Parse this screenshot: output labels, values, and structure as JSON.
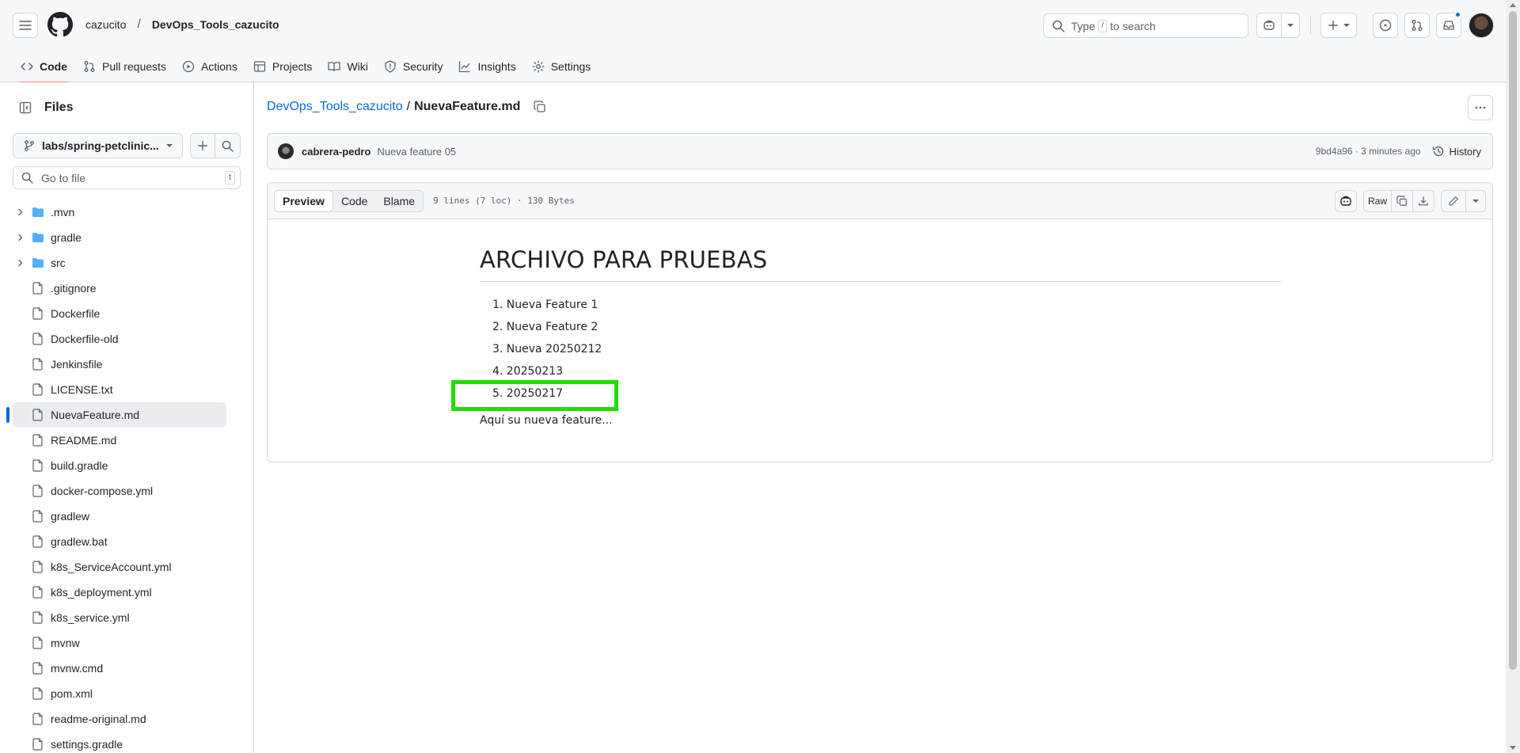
{
  "header": {
    "owner": "cazucito",
    "separator": "/",
    "repo": "DevOps_Tools_cazucito",
    "search_pre": "Type",
    "search_key": "/",
    "search_post": "to search"
  },
  "tabs": [
    {
      "label": "Code",
      "icon": "code-icon"
    },
    {
      "label": "Pull requests",
      "icon": "pull-request-icon"
    },
    {
      "label": "Actions",
      "icon": "play-icon"
    },
    {
      "label": "Projects",
      "icon": "table-icon"
    },
    {
      "label": "Wiki",
      "icon": "book-icon"
    },
    {
      "label": "Security",
      "icon": "shield-icon"
    },
    {
      "label": "Insights",
      "icon": "graph-icon"
    },
    {
      "label": "Settings",
      "icon": "gear-icon"
    }
  ],
  "sidebar": {
    "title": "Files",
    "branch": "labs/spring-petclinic...",
    "goto_placeholder": "Go to file",
    "goto_key": "t",
    "items": [
      {
        "name": ".mvn",
        "type": "dir"
      },
      {
        "name": "gradle",
        "type": "dir"
      },
      {
        "name": "src",
        "type": "dir"
      },
      {
        "name": ".gitignore",
        "type": "file"
      },
      {
        "name": "Dockerfile",
        "type": "file"
      },
      {
        "name": "Dockerfile-old",
        "type": "file"
      },
      {
        "name": "Jenkinsfile",
        "type": "file"
      },
      {
        "name": "LICENSE.txt",
        "type": "file"
      },
      {
        "name": "NuevaFeature.md",
        "type": "file",
        "selected": true
      },
      {
        "name": "README.md",
        "type": "file"
      },
      {
        "name": "build.gradle",
        "type": "file"
      },
      {
        "name": "docker-compose.yml",
        "type": "file"
      },
      {
        "name": "gradlew",
        "type": "file"
      },
      {
        "name": "gradlew.bat",
        "type": "file"
      },
      {
        "name": "k8s_ServiceAccount.yml",
        "type": "file"
      },
      {
        "name": "k8s_deployment.yml",
        "type": "file"
      },
      {
        "name": "k8s_service.yml",
        "type": "file"
      },
      {
        "name": "mvnw",
        "type": "file"
      },
      {
        "name": "mvnw.cmd",
        "type": "file"
      },
      {
        "name": "pom.xml",
        "type": "file"
      },
      {
        "name": "readme-original.md",
        "type": "file"
      },
      {
        "name": "settings.gradle",
        "type": "file"
      }
    ]
  },
  "breadcrumb": {
    "repo": "DevOps_Tools_cazucito",
    "sep": "/",
    "file": "NuevaFeature.md"
  },
  "commit": {
    "author": "cabrera-pedro",
    "message": "Nueva feature 05",
    "meta": "9bd4a96 · 3 minutes ago",
    "history_label": "History"
  },
  "file_view": {
    "tabs": [
      "Preview",
      "Code",
      "Blame"
    ],
    "info": "9 lines (7 loc) · 130 Bytes",
    "raw_label": "Raw"
  },
  "markdown": {
    "heading": "ARCHIVO PARA PRUEBAS",
    "items": [
      "1. Nueva Feature 1",
      "2. Nueva Feature 2",
      "3. Nueva 20250212",
      "4. 20250213",
      "5. 20250217"
    ],
    "paragraph": "Aquí su nueva feature..."
  },
  "colors": {
    "accent_link": "#0969da",
    "tab_underline": "#fd8c73",
    "highlight_box": "#22dd00"
  }
}
